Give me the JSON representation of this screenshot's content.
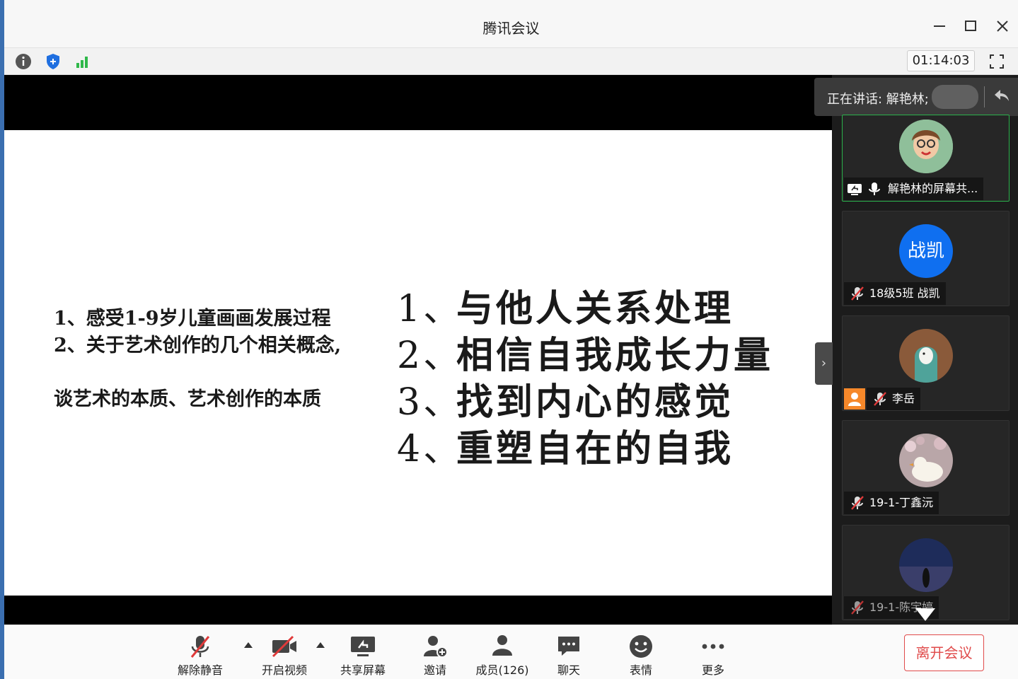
{
  "window": {
    "title": "腾讯会议",
    "minimize_icon": "minimize-icon",
    "maximize_icon": "maximize-icon",
    "close_icon": "close-icon"
  },
  "statusbar": {
    "icons": [
      "info-icon",
      "shield-icon",
      "signal-icon"
    ],
    "timer": "01:14:03",
    "fullscreen_icon": "fullscreen-icon",
    "colors": {
      "shield": "#1f6fe0",
      "signal": "#2fb84a"
    }
  },
  "slide": {
    "left_lines": [
      "1、感受1-9岁儿童画画发展过程",
      "2、关于艺术创作的几个相关概念,",
      "谈艺术的本质、艺术创作的本质"
    ],
    "right_items": [
      {
        "num": "1、",
        "text": "与他人关系处理"
      },
      {
        "num": "2、",
        "text": "相信自我成长力量"
      },
      {
        "num": "3、",
        "text": "找到内心的感觉"
      },
      {
        "num": "4、",
        "text": "重塑自在的自我"
      }
    ]
  },
  "side_panel": {
    "speaking_label": "正在讲话: 解艳林;",
    "participants": [
      {
        "name": "解艳林的屏幕共...",
        "avatar": "cartoon-avatar",
        "mic": "mic-on",
        "sharing": true
      },
      {
        "name": "18级5班 战凯",
        "avatar_text": "战凯",
        "mic": "mic-muted"
      },
      {
        "name": "李岳",
        "avatar": "hoodie-avatar",
        "mic": "mic-muted",
        "host_badge": true
      },
      {
        "name": "19-1-丁鑫沅",
        "avatar": "duck-avatar",
        "mic": "mic-muted"
      },
      {
        "name": "19-1-陈宇婷",
        "avatar": "night-avatar",
        "mic": "mic-muted"
      }
    ],
    "colors": {
      "active_border": "#2bb24c",
      "avatar_blue": "#0f6ff0",
      "host_orange": "#f6882a"
    }
  },
  "toolbar": {
    "unmute": "解除静音",
    "video": "开启视频",
    "share": "共享屏幕",
    "invite": "邀请",
    "members": "成员(126)",
    "chat": "聊天",
    "emoji": "表情",
    "more": "更多",
    "leave": "离开会议",
    "colors": {
      "leave": "#e04b4b"
    }
  }
}
